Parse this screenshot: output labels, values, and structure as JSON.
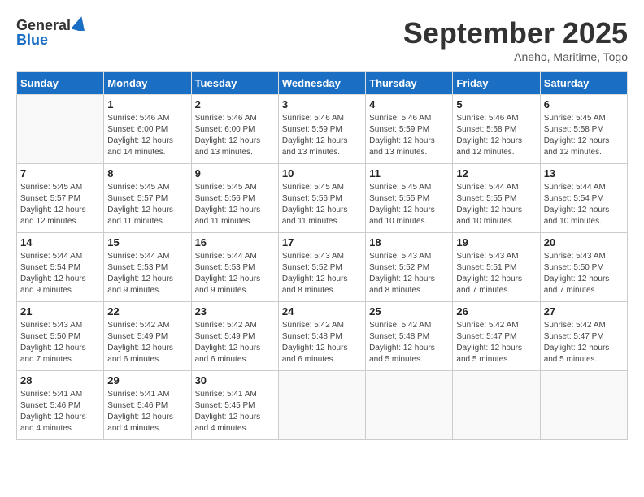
{
  "header": {
    "logo_general": "General",
    "logo_blue": "Blue",
    "month_title": "September 2025",
    "subtitle": "Aneho, Maritime, Togo"
  },
  "weekdays": [
    "Sunday",
    "Monday",
    "Tuesday",
    "Wednesday",
    "Thursday",
    "Friday",
    "Saturday"
  ],
  "weeks": [
    [
      {
        "day": "",
        "info": ""
      },
      {
        "day": "1",
        "info": "Sunrise: 5:46 AM\nSunset: 6:00 PM\nDaylight: 12 hours\nand 14 minutes."
      },
      {
        "day": "2",
        "info": "Sunrise: 5:46 AM\nSunset: 6:00 PM\nDaylight: 12 hours\nand 13 minutes."
      },
      {
        "day": "3",
        "info": "Sunrise: 5:46 AM\nSunset: 5:59 PM\nDaylight: 12 hours\nand 13 minutes."
      },
      {
        "day": "4",
        "info": "Sunrise: 5:46 AM\nSunset: 5:59 PM\nDaylight: 12 hours\nand 13 minutes."
      },
      {
        "day": "5",
        "info": "Sunrise: 5:46 AM\nSunset: 5:58 PM\nDaylight: 12 hours\nand 12 minutes."
      },
      {
        "day": "6",
        "info": "Sunrise: 5:45 AM\nSunset: 5:58 PM\nDaylight: 12 hours\nand 12 minutes."
      }
    ],
    [
      {
        "day": "7",
        "info": "Sunrise: 5:45 AM\nSunset: 5:57 PM\nDaylight: 12 hours\nand 12 minutes."
      },
      {
        "day": "8",
        "info": "Sunrise: 5:45 AM\nSunset: 5:57 PM\nDaylight: 12 hours\nand 11 minutes."
      },
      {
        "day": "9",
        "info": "Sunrise: 5:45 AM\nSunset: 5:56 PM\nDaylight: 12 hours\nand 11 minutes."
      },
      {
        "day": "10",
        "info": "Sunrise: 5:45 AM\nSunset: 5:56 PM\nDaylight: 12 hours\nand 11 minutes."
      },
      {
        "day": "11",
        "info": "Sunrise: 5:45 AM\nSunset: 5:55 PM\nDaylight: 12 hours\nand 10 minutes."
      },
      {
        "day": "12",
        "info": "Sunrise: 5:44 AM\nSunset: 5:55 PM\nDaylight: 12 hours\nand 10 minutes."
      },
      {
        "day": "13",
        "info": "Sunrise: 5:44 AM\nSunset: 5:54 PM\nDaylight: 12 hours\nand 10 minutes."
      }
    ],
    [
      {
        "day": "14",
        "info": "Sunrise: 5:44 AM\nSunset: 5:54 PM\nDaylight: 12 hours\nand 9 minutes."
      },
      {
        "day": "15",
        "info": "Sunrise: 5:44 AM\nSunset: 5:53 PM\nDaylight: 12 hours\nand 9 minutes."
      },
      {
        "day": "16",
        "info": "Sunrise: 5:44 AM\nSunset: 5:53 PM\nDaylight: 12 hours\nand 9 minutes."
      },
      {
        "day": "17",
        "info": "Sunrise: 5:43 AM\nSunset: 5:52 PM\nDaylight: 12 hours\nand 8 minutes."
      },
      {
        "day": "18",
        "info": "Sunrise: 5:43 AM\nSunset: 5:52 PM\nDaylight: 12 hours\nand 8 minutes."
      },
      {
        "day": "19",
        "info": "Sunrise: 5:43 AM\nSunset: 5:51 PM\nDaylight: 12 hours\nand 7 minutes."
      },
      {
        "day": "20",
        "info": "Sunrise: 5:43 AM\nSunset: 5:50 PM\nDaylight: 12 hours\nand 7 minutes."
      }
    ],
    [
      {
        "day": "21",
        "info": "Sunrise: 5:43 AM\nSunset: 5:50 PM\nDaylight: 12 hours\nand 7 minutes."
      },
      {
        "day": "22",
        "info": "Sunrise: 5:42 AM\nSunset: 5:49 PM\nDaylight: 12 hours\nand 6 minutes."
      },
      {
        "day": "23",
        "info": "Sunrise: 5:42 AM\nSunset: 5:49 PM\nDaylight: 12 hours\nand 6 minutes."
      },
      {
        "day": "24",
        "info": "Sunrise: 5:42 AM\nSunset: 5:48 PM\nDaylight: 12 hours\nand 6 minutes."
      },
      {
        "day": "25",
        "info": "Sunrise: 5:42 AM\nSunset: 5:48 PM\nDaylight: 12 hours\nand 5 minutes."
      },
      {
        "day": "26",
        "info": "Sunrise: 5:42 AM\nSunset: 5:47 PM\nDaylight: 12 hours\nand 5 minutes."
      },
      {
        "day": "27",
        "info": "Sunrise: 5:42 AM\nSunset: 5:47 PM\nDaylight: 12 hours\nand 5 minutes."
      }
    ],
    [
      {
        "day": "28",
        "info": "Sunrise: 5:41 AM\nSunset: 5:46 PM\nDaylight: 12 hours\nand 4 minutes."
      },
      {
        "day": "29",
        "info": "Sunrise: 5:41 AM\nSunset: 5:46 PM\nDaylight: 12 hours\nand 4 minutes."
      },
      {
        "day": "30",
        "info": "Sunrise: 5:41 AM\nSunset: 5:45 PM\nDaylight: 12 hours\nand 4 minutes."
      },
      {
        "day": "",
        "info": ""
      },
      {
        "day": "",
        "info": ""
      },
      {
        "day": "",
        "info": ""
      },
      {
        "day": "",
        "info": ""
      }
    ]
  ]
}
